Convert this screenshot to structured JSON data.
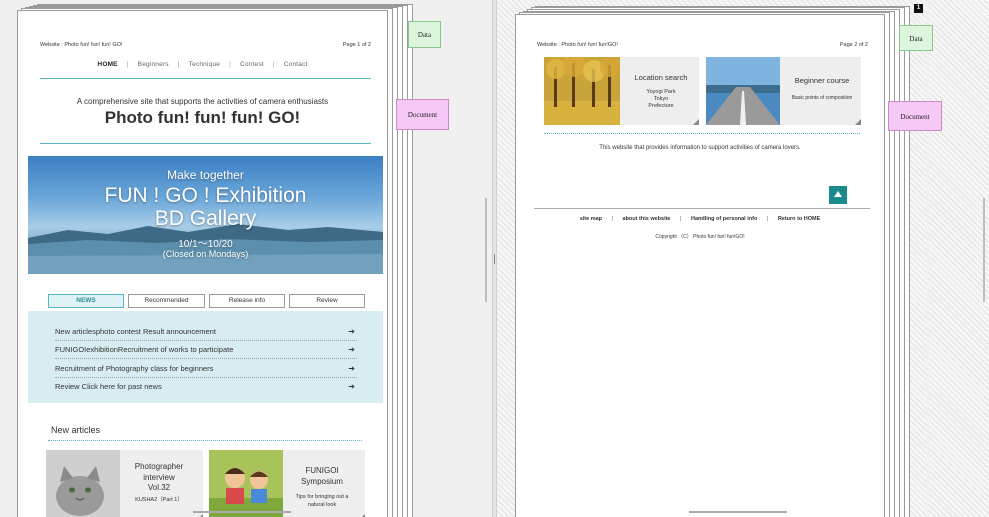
{
  "left_page": {
    "site_label": "Website : Photo fun! fun! fun! GO!",
    "page_number": "Page 1 of 2",
    "nav": [
      "HOME",
      "Beginners",
      "Technique",
      "Contest",
      "Contact"
    ],
    "tagline": "A comprehensive site that supports the activities of camera enthusiasts",
    "title": "Photo fun! fun! fun! GO!",
    "banner": {
      "line1": "Make together",
      "line2": "FUN ! GO ! Exhibition",
      "line3": "BD Gallery",
      "line4": "10/1〜10/20",
      "line5": "(Closed on Mondays)"
    },
    "tabs": [
      "NEWS",
      "Recommended",
      "Release info",
      "Review"
    ],
    "news": [
      "New articlesphoto contest Result announcement",
      "FUNIGOIexhibitionRecruitment of works to participate",
      "Recruitment of Photography class for beginners",
      "Review Click here for past news"
    ],
    "news_arrow": "➔",
    "new_articles_title": "New articles",
    "cards": [
      {
        "title1": "Photographer",
        "title2": "interview",
        "title3": "Vol.32",
        "sub": "KUSHA2（Part 1）"
      },
      {
        "title1": "FUNIGOI",
        "title2": "Symposium",
        "sub1": "Tips for bringing out a",
        "sub2": "natural look"
      }
    ]
  },
  "right_page": {
    "site_label": "Website : Photo fun! fun! fun!GO!",
    "page_number": "Page 2 of 2",
    "cards": [
      {
        "title": "Location search",
        "sub1": "Yoyogi Park",
        "sub2": "Tokyo",
        "sub3": "Prefecture"
      },
      {
        "title": "Beginner course",
        "sub": "Basic points of composition"
      }
    ],
    "info": "This website that provides information to support activities of camera lovers.",
    "footer_links": [
      "site map",
      "about this website",
      "Handling of personal info",
      "Return to HOME"
    ],
    "copyright": "Copyright （C） Photo fun! fun! fun!GO!"
  },
  "labels": {
    "data": "Data",
    "document": "Document"
  },
  "badge": "1",
  "colors": {
    "accent": "#58b5c5",
    "news_bg": "#d8edf1",
    "data_label": "#dcf5dc",
    "document_label": "#f6c8f6",
    "up_button": "#1a8a8c"
  }
}
